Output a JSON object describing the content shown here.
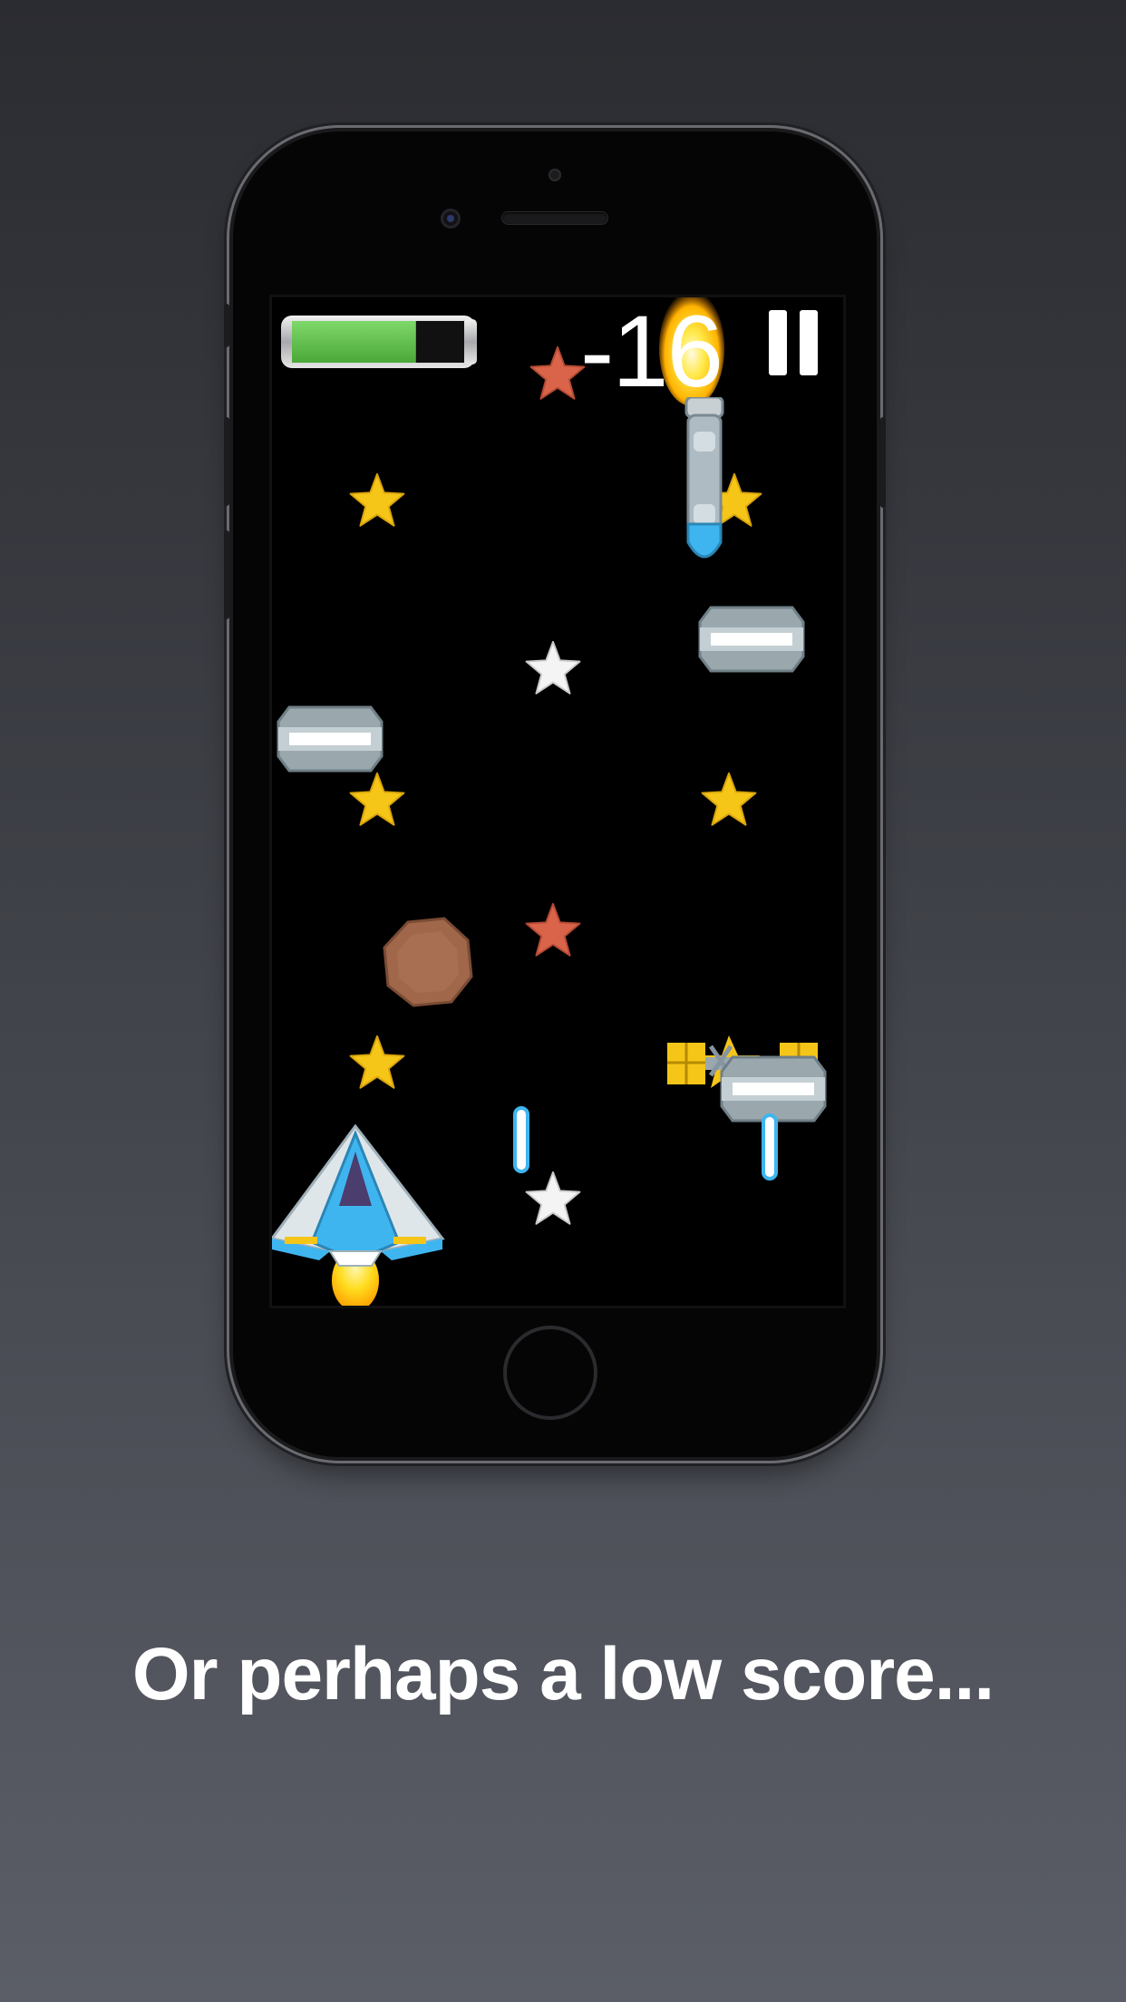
{
  "hud": {
    "health_fraction": 0.72,
    "score": "-16",
    "pause_icon": "pause-icon"
  },
  "caption": "Or perhaps a low score...",
  "colors": {
    "background_top": "#2b2c31",
    "background_bottom": "#5b5e67",
    "health_fill": "#5fc24a",
    "star_gold": "#f5c518",
    "star_red": "#d9644a",
    "star_white": "#f2f2f2",
    "laser_blue": "#3fb5f0"
  }
}
